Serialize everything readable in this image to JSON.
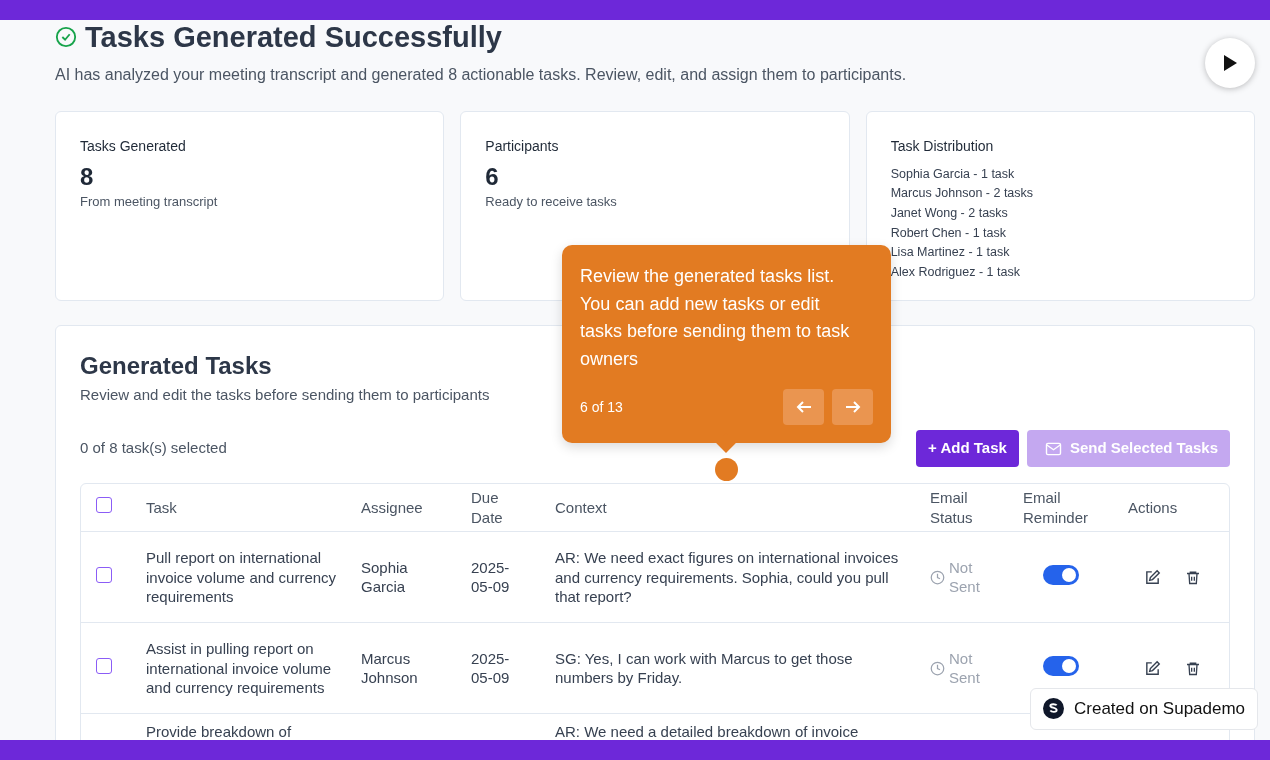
{
  "header": {
    "title": "Tasks Generated Successfully",
    "subtitle": "AI has analyzed your meeting transcript and generated 8 actionable tasks. Review, edit, and assign them to participants."
  },
  "stats": [
    {
      "kind": "number",
      "label": "Tasks Generated",
      "value": "8",
      "caption": "From meeting transcript"
    },
    {
      "kind": "number",
      "label": "Participants",
      "value": "6",
      "caption": "Ready to receive tasks"
    },
    {
      "kind": "list",
      "label": "Task Distribution",
      "items": [
        "Sophia Garcia - 1 task",
        "Marcus Johnson - 2 tasks",
        "Janet Wong - 2 tasks",
        "Robert Chen - 1 task",
        "Lisa Martinez - 1 task",
        "Alex Rodriguez - 1 task"
      ]
    }
  ],
  "tasks_panel": {
    "title": "Generated Tasks",
    "subtitle": "Review and edit the tasks before sending them to participants",
    "selection_count": "0 of 8 task(s) selected",
    "buttons": [
      {
        "kind": "add",
        "label": "+ Add Task",
        "disabled": false
      },
      {
        "kind": "send",
        "label": "Send Selected Tasks",
        "disabled": true
      }
    ],
    "table": {
      "select_all_checked": false,
      "columns": [
        "Task",
        "Assignee",
        "Due Date",
        "Context",
        "Email Status",
        "Email Reminder",
        "Actions"
      ],
      "rows": [
        {
          "checked": false,
          "task": "Pull report on international invoice volume and currency requirements",
          "assignee": "Sophia Garcia",
          "due": "2025-05-09",
          "context": "AR: We need exact figures on international invoices and currency requirements. Sophia, could you pull that report?",
          "email_status": "Not Sent",
          "reminder_on": true
        },
        {
          "checked": false,
          "task": "Assist in pulling report on international invoice volume and currency requirements",
          "assignee": "Marcus Johnson",
          "due": "2025-05-09",
          "context": "SG: Yes, I can work with Marcus to get those numbers by Friday.",
          "email_status": "Not Sent",
          "reminder_on": true
        },
        {
          "task": "Provide breakdown of",
          "context": "AR: We need a detailed breakdown of invoice"
        }
      ]
    }
  },
  "tour_tooltip": {
    "text": "Review the generated tasks list. You can add new tasks or edit tasks before sending them to task owners",
    "step": "6 of 13"
  },
  "badge": {
    "text": "Created on Supademo"
  }
}
